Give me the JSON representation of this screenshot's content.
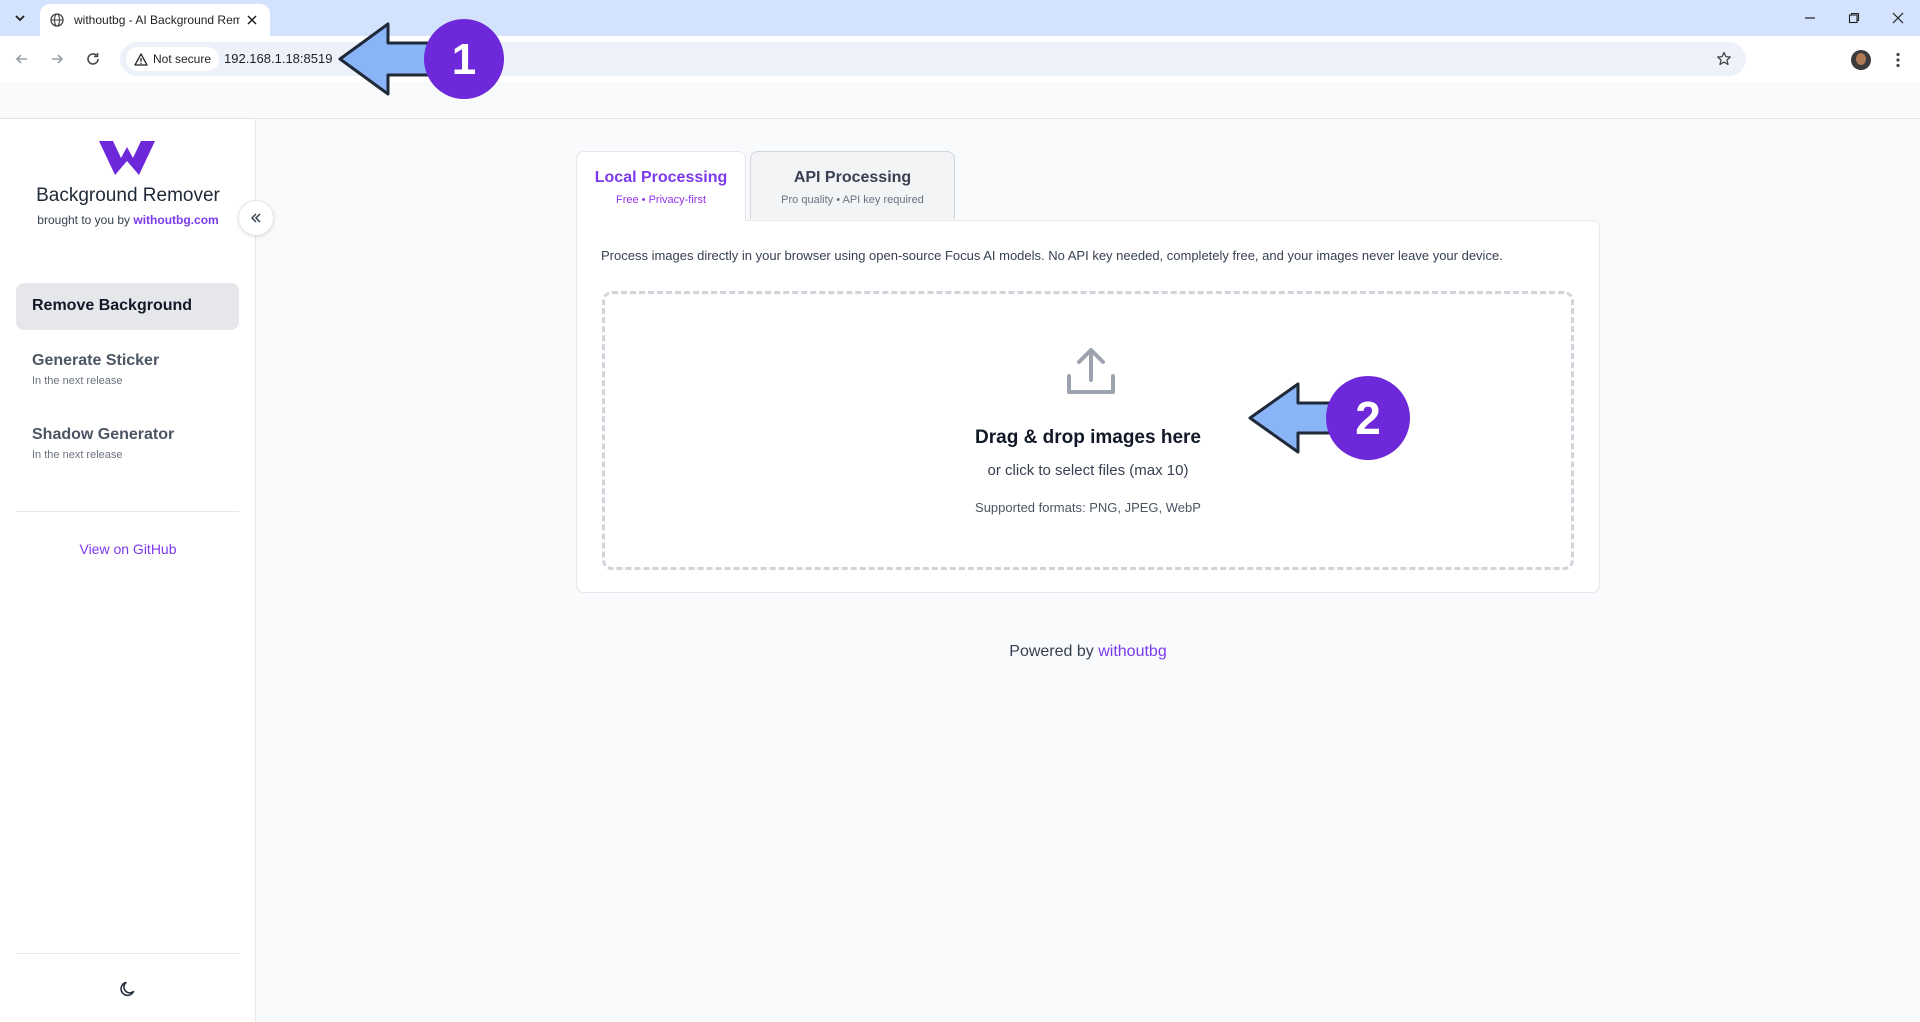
{
  "browser": {
    "tab_title": "withoutbg - AI Background Remover",
    "security_label": "Not secure",
    "url": "192.168.1.18:8519"
  },
  "sidebar": {
    "brand_title": "Background Remover",
    "brand_sub_prefix": "brought to you by ",
    "brand_sub_link": "withoutbg.com",
    "nav_items": [
      {
        "label": "Remove Background",
        "sub": ""
      },
      {
        "label": "Generate Sticker",
        "sub": "In the next release"
      },
      {
        "label": "Shadow Generator",
        "sub": "In the next release"
      }
    ],
    "github_link": "View on GitHub"
  },
  "main": {
    "tabs": [
      {
        "label": "Local Processing",
        "sub": "Free • Privacy-first"
      },
      {
        "label": "API Processing",
        "sub": "Pro quality • API key required"
      }
    ],
    "description": "Process images directly in your browser using open-source Focus AI models. No API key needed, completely free, and your images never leave your device.",
    "dropzone": {
      "title": "Drag & drop images here",
      "subtitle": "or click to select files (max 10)",
      "formats": "Supported formats: PNG, JPEG, WebP"
    },
    "footer_prefix": "Powered by ",
    "footer_link": "withoutbg"
  },
  "annotations": {
    "marker_1": "1",
    "marker_2": "2"
  },
  "colors": {
    "accent": "#7c3aed",
    "annotation_arrow": "#8ab4f8",
    "annotation_circle": "#6d28d9"
  }
}
